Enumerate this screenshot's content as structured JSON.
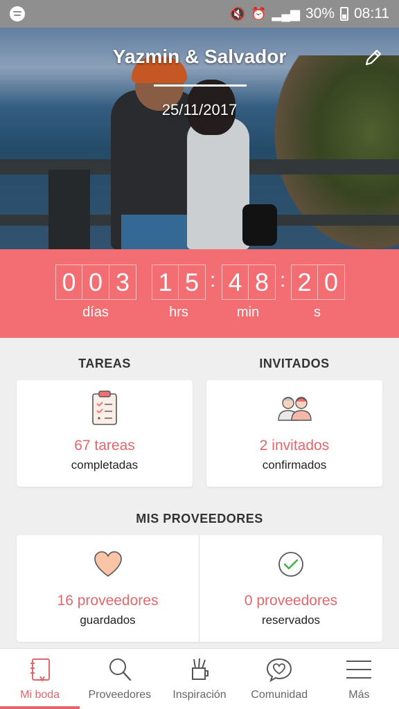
{
  "status_bar": {
    "battery": "30%",
    "time": "08:11"
  },
  "hero": {
    "couple_names": "Yazmin & Salvador",
    "date": "25/11/2017"
  },
  "countdown": {
    "days_digits": [
      "0",
      "0",
      "3"
    ],
    "hours_digits": [
      "1",
      "5"
    ],
    "minutes_digits": [
      "4",
      "8"
    ],
    "seconds_digits": [
      "2",
      "0"
    ],
    "days_label": "días",
    "hours_label": "hrs",
    "minutes_label": "min",
    "seconds_label": "s"
  },
  "tasks": {
    "title": "TAREAS",
    "count_text": "67 tareas",
    "status_text": "completadas"
  },
  "guests": {
    "title": "INVITADOS",
    "count_text": "2 invitados",
    "status_text": "confirmados"
  },
  "vendors": {
    "title": "MIS PROVEEDORES",
    "saved_count": "16 proveedores",
    "saved_label": "guardados",
    "booked_count": "0 proveedores",
    "booked_label": "reservados"
  },
  "bottom_nav": {
    "items": [
      {
        "label": "Mi boda",
        "icon": "notebook-icon",
        "active": true
      },
      {
        "label": "Proveedores",
        "icon": "search-icon",
        "active": false
      },
      {
        "label": "Inspiración",
        "icon": "inspiration-cup-icon",
        "active": false
      },
      {
        "label": "Comunidad",
        "icon": "chat-heart-icon",
        "active": false
      },
      {
        "label": "Más",
        "icon": "menu-icon",
        "active": false
      }
    ]
  },
  "colors": {
    "accent": "#f26e72",
    "accent_text": "#e1676b",
    "status_bar": "#8f8f8f"
  }
}
